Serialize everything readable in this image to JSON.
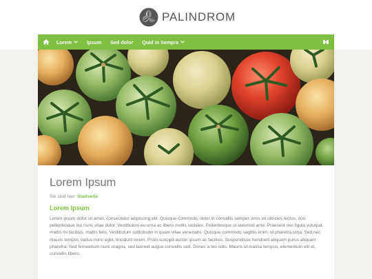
{
  "brand": {
    "name": "PALINDROM",
    "logo_icon": "tri-swirl-logo-icon"
  },
  "nav": {
    "home_icon": "home-icon",
    "items": [
      {
        "label": "Lorem",
        "dropdown": true
      },
      {
        "label": "Ipsum",
        "dropdown": false
      },
      {
        "label": "Sed dolor",
        "dropdown": false
      },
      {
        "label": "Quid in Sempra",
        "dropdown": true
      }
    ],
    "search_icon": "search-icon"
  },
  "colors": {
    "accent": "#7dc142",
    "background": "#f3f1ee",
    "text": "#777777"
  },
  "hero": {
    "image": "green-and-red-tomatoes-photo"
  },
  "content": {
    "title": "Lorem Ipsum",
    "breadcrumb_prefix": "Sie sind hier:",
    "breadcrumb_link": "Startseite",
    "section_title": "Lorem Ipsum",
    "paragraph": "Lorem ipsum dolor sit amet, consectetur adipiscing elit. Quisque commodo, dolor in convallis semper, eros ex ultricies lectus, non pellentesque leo nunc vitae dolor. Vestibulum eu urna ac libero mollis sodales. Pellentesque ut euismod ante. Praesent nec ligula volutpat, mattis mi facilisis, mattis felis. Vestibulum sollicitudin in quam vitae venenatis. Quisque commodo sagittis enim, id pharetra urna. Sed nec mauris tempor, varius nunc eget, tincidunt lorem. Proin suscipit auctor ipsum ac facilisis. Suspendisse hendrerit aliquam purus aliquam pharetra. Sed fermentum nunc magna, sed laoreet augue convallis sed. Donec a leo odio. Mauris ut massa tempus, elementum elit et, convallis libero."
  }
}
